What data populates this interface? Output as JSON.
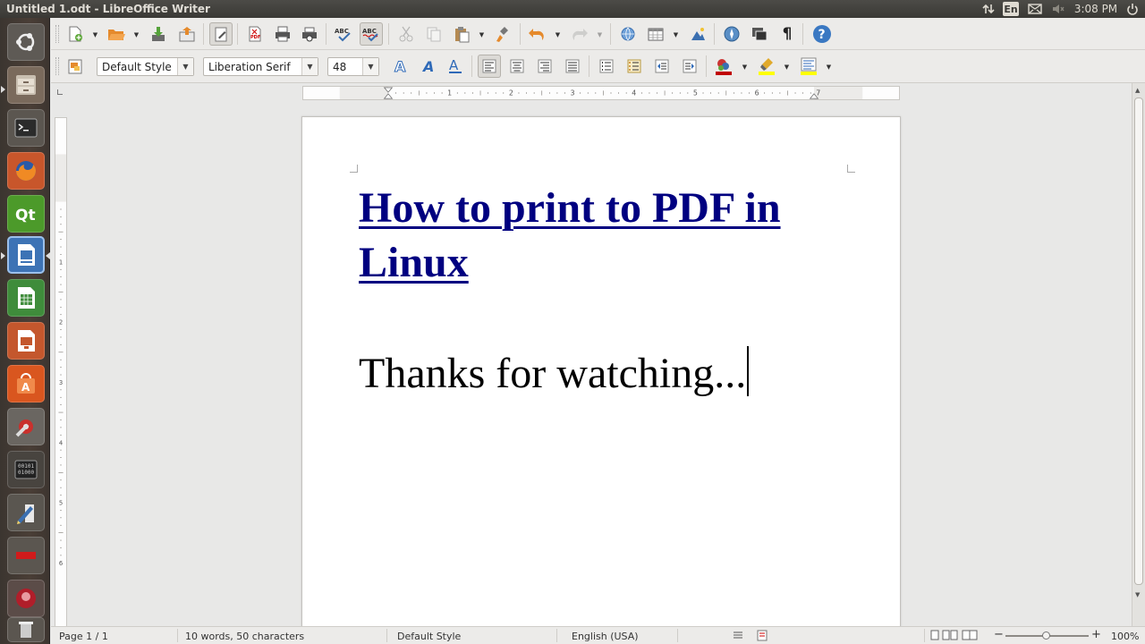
{
  "window": {
    "title": "Untitled 1.odt - LibreOffice Writer"
  },
  "top_panel": {
    "indicators": [
      "network-icon",
      "keyboard-layout",
      "mail-icon",
      "volume-icon",
      "clock",
      "power-icon"
    ],
    "keyboard_layout": "En",
    "clock": "3:08 PM"
  },
  "launcher": {
    "items": [
      "Dash",
      "Files",
      "Terminal",
      "Firefox Web Browser",
      "Qt Creator",
      "LibreOffice Writer",
      "LibreOffice Calc",
      "LibreOffice Impress",
      "Ubuntu Software Center",
      "System Settings",
      "Binary Clock",
      "Text Editor",
      "Red Application",
      "Red Circle Application",
      "Trash"
    ]
  },
  "formatting": {
    "paragraph_style": "Default Style",
    "font_name": "Liberation Serif",
    "font_size": "48"
  },
  "document": {
    "heading": "How to print to PDF in Linux",
    "body": "Thanks for watching...",
    "heading_color": "#000080"
  },
  "ruler": {
    "labels": [
      "1",
      "2",
      "3",
      "4",
      "5",
      "6",
      "7"
    ],
    "vlabels": [
      "1",
      "2",
      "3",
      "4",
      "5",
      "6"
    ]
  },
  "status": {
    "page": "Page 1 / 1",
    "words": "10 words, 50 characters",
    "style": "Default Style",
    "language": "English (USA)",
    "zoom": "100%"
  }
}
